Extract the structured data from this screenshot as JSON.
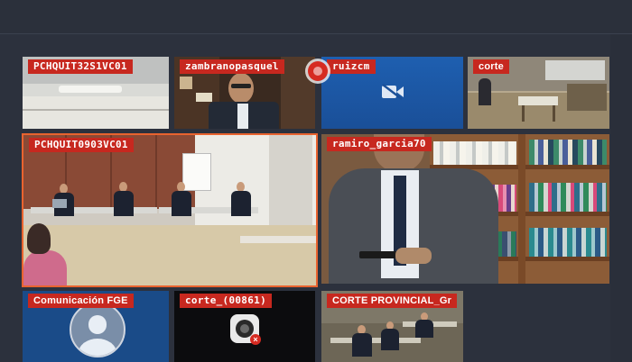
{
  "tiles": [
    {
      "name": "PCHQUIT32S1VC01"
    },
    {
      "name": "zambranopasquel"
    },
    {
      "name": "ruizcm"
    },
    {
      "name": "corte"
    },
    {
      "name": "PCHQUIT0903VC01"
    },
    {
      "name": "ramiro_garcia70"
    },
    {
      "name": "Comunicación FGE"
    },
    {
      "name": "corte_(00861)"
    },
    {
      "name": "CORTE PROVINCIAL_Gr"
    }
  ],
  "icons": {
    "camera_off": "video-off-icon",
    "recording": "record-icon",
    "avatar": "user-avatar-icon",
    "no_video": "camera-muted-icon"
  },
  "colors": {
    "label_bg": "#c7281f",
    "active_border": "#e9632f",
    "app_bg": "#2c313d"
  }
}
